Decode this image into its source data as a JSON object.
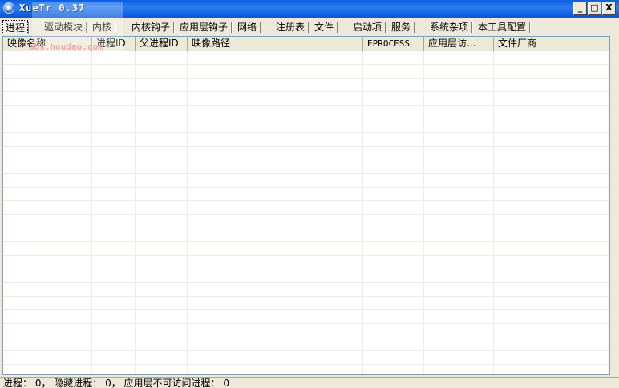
{
  "window": {
    "title": "XueTr 0.37",
    "icon": "app-icon",
    "watermark_text": "bbs.houdao.com",
    "controls": {
      "minimize": "_",
      "maximize": "□",
      "close": "X"
    }
  },
  "tabs": [
    {
      "label": "进程",
      "active": true
    },
    {
      "label": "驱动模块"
    },
    {
      "label": "内核"
    },
    {
      "label": "内核钩子"
    },
    {
      "label": "应用层钩子"
    },
    {
      "label": "网络"
    },
    {
      "label": "注册表"
    },
    {
      "label": "文件"
    },
    {
      "label": "启动项"
    },
    {
      "label": "服务"
    },
    {
      "label": "系统杂项"
    },
    {
      "label": "本工具配置"
    }
  ],
  "columns": [
    "映像名称",
    "进程ID",
    "父进程ID",
    "映像路径",
    "EPROCESS",
    "应用层访...",
    "文件厂商"
  ],
  "rows": [],
  "status": {
    "text": "进程： 0， 隐藏进程： 0， 应用层不可访问进程： 0"
  },
  "colors": {
    "titlebar": "#0a5fe0",
    "face": "#ece9d8",
    "grid": "#ecebe4"
  }
}
